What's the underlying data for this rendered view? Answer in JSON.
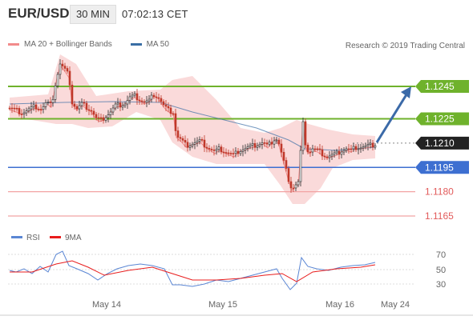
{
  "header": {
    "symbol": "EUR/USD",
    "timeframe": "30 MIN",
    "time": "07:02:13 CET"
  },
  "legend": {
    "ma20_label": "MA 20 + Bollinger Bands",
    "ma50_label": "MA 50",
    "ma20_color": "#f28b8b",
    "ma50_color": "#3a6ea5"
  },
  "credit": "Research © 2019 Trading Central",
  "levels": [
    {
      "value": "1.1245",
      "style": "green"
    },
    {
      "value": "1.1225",
      "style": "green"
    },
    {
      "value": "1.1210",
      "style": "black"
    },
    {
      "value": "1.1195",
      "style": "blue"
    },
    {
      "value": "1.1180",
      "style": "red"
    },
    {
      "value": "1.1165",
      "style": "red"
    }
  ],
  "rsi": {
    "rsi_label": "RSI",
    "ma_label": "9MA",
    "rsi_color": "#5a86d4",
    "ma_color": "#e81c1c",
    "ticks": [
      "70",
      "50",
      "30"
    ]
  },
  "x_axis": {
    "labels": [
      "May 14",
      "May 15",
      "May 16",
      "May 24"
    ]
  },
  "colors": {
    "green": "#6fb22c",
    "blue": "#3d6fd1",
    "red": "#f2a3a3",
    "black": "#222222",
    "arrow": "#3b6aa8",
    "band": "#fadada"
  }
}
